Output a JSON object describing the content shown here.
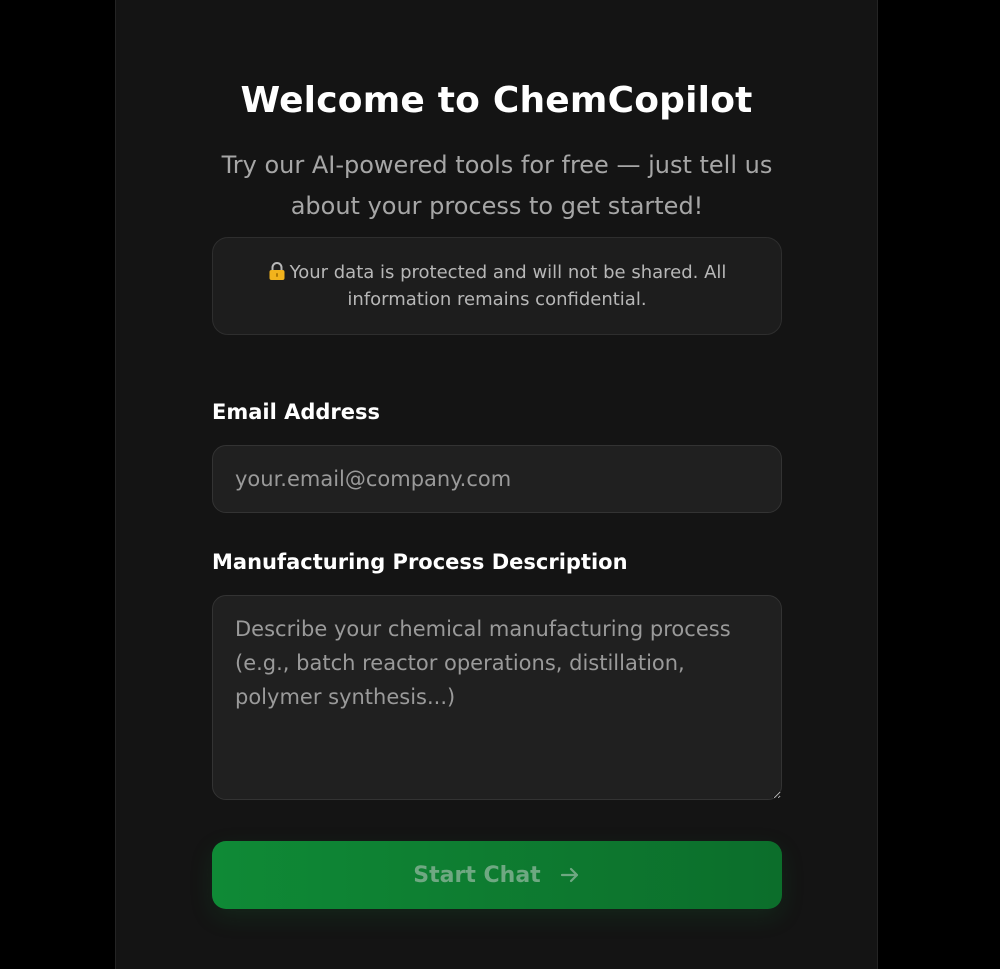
{
  "header": {
    "title": "Welcome to ChemCopilot",
    "subtitle": "Try our AI-powered tools for free — just tell us about your process to get started!"
  },
  "notice": {
    "icon": "lock-icon",
    "text": "Your data is protected and will not be shared. All information remains confidential."
  },
  "form": {
    "email_label": "Email Address",
    "email_placeholder": "your.email@company.com",
    "email_value": "",
    "description_label": "Manufacturing Process Description",
    "description_placeholder": "Describe your chemical manufacturing process (e.g., batch reactor operations, distillation, polymer synthesis...)",
    "description_value": "",
    "submit_label": "Start Chat",
    "submit_icon": "arrow-right-icon"
  },
  "colors": {
    "background": "#000000",
    "panel": "#141414",
    "accent": "#0f8a36"
  }
}
